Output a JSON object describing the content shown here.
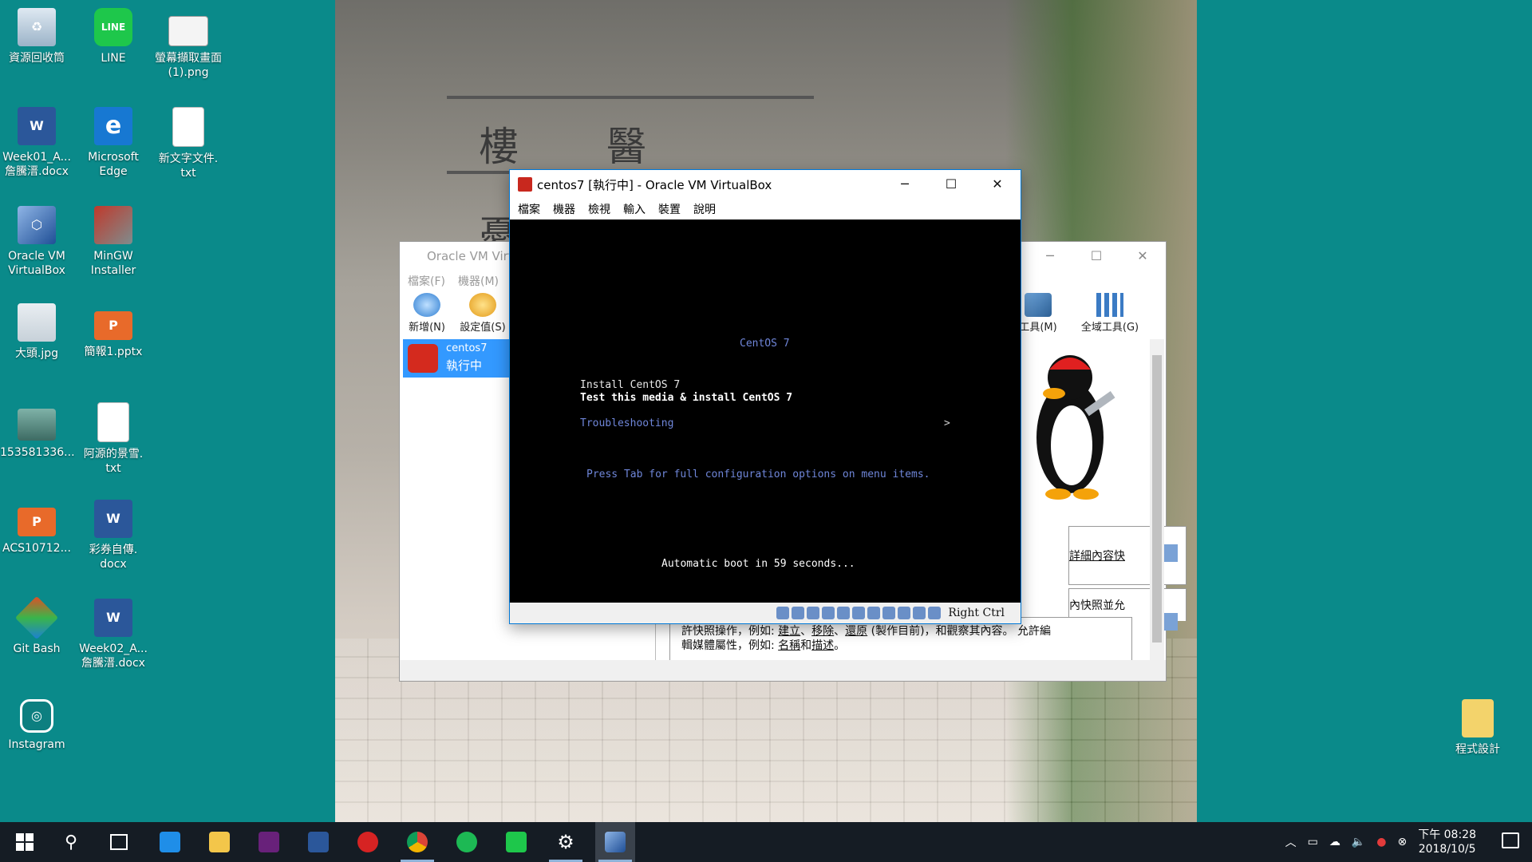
{
  "desktop_icons": [
    {
      "label": "資源回收筒",
      "icon": "recycle-bin-icon"
    },
    {
      "label": "LINE",
      "icon": "line-icon"
    },
    {
      "label": "螢幕擷取畫面\n(1).png",
      "icon": "image-file-icon"
    },
    {
      "label": "Week01_A...\n詹騰溍.docx",
      "icon": "word-doc-icon"
    },
    {
      "label": "Microsoft\nEdge",
      "icon": "edge-icon"
    },
    {
      "label": "新文字文件.\ntxt",
      "icon": "text-file-icon"
    },
    {
      "label": "Oracle VM\nVirtualBox",
      "icon": "virtualbox-icon"
    },
    {
      "label": "MinGW\nInstaller",
      "icon": "mingw-icon"
    },
    {
      "label": "大頭.jpg",
      "icon": "photo-icon"
    },
    {
      "label": "簡報1.pptx",
      "icon": "powerpoint-icon"
    },
    {
      "label": "153581336...",
      "icon": "photo-icon"
    },
    {
      "label": "阿源的景雪.\ntxt",
      "icon": "text-file-icon"
    },
    {
      "label": "ACS10712...",
      "icon": "powerpoint-icon"
    },
    {
      "label": "彩券自傳.\ndocx",
      "icon": "word-doc-icon"
    },
    {
      "label": "Git Bash",
      "icon": "git-bash-icon"
    },
    {
      "label": "Week02_A...\n詹騰溍.docx",
      "icon": "word-doc-icon"
    },
    {
      "label": "Instagram",
      "icon": "instagram-icon"
    },
    {
      "label": "程式設計",
      "icon": "folder-icon"
    }
  ],
  "wallpaper": {
    "sign": [
      "樓",
      "醫",
      "憂"
    ]
  },
  "manager": {
    "title": "Oracle VM Virt",
    "menu": [
      "檔案(F)",
      "機器(M)"
    ],
    "tools": {
      "new": "新增(N)",
      "settings": "設定值(S)",
      "machine_tools": "工具(M)",
      "global_tools": "全域工具(G)"
    },
    "vm": {
      "name": "centos7",
      "state": "執行中"
    },
    "details_link": "詳細內容快",
    "snapshot_partial": "內快照並允",
    "snapshot_line1_a": "許快照操作，例如: ",
    "snapshot_create": "建立",
    "snapshot_remove": "移除",
    "snapshot_restore": "還原",
    "snapshot_line1_b": " (製作目前)，和觀察其內容。 允許編",
    "snapshot_line2_a": "輯媒體屬性，例如: ",
    "snapshot_name": "名稱",
    "snapshot_and": "和",
    "snapshot_desc": "描述",
    "snapshot_end": "。"
  },
  "vm_window": {
    "title": "centos7 [執行中] - Oracle VM VirtualBox",
    "menu": [
      "檔案",
      "機器",
      "檢視",
      "輸入",
      "裝置",
      "說明"
    ],
    "boot": {
      "header": "CentOS 7",
      "option1": "Install CentOS 7",
      "option2": "Test this media & install CentOS 7",
      "option3": "Troubleshooting",
      "arrow": ">",
      "hint": "Press Tab for full configuration options on menu items.",
      "countdown": "Automatic boot in 59 seconds..."
    },
    "host_key": "Right Ctrl"
  },
  "taskbar": {
    "apps": [
      "start",
      "search",
      "task-view",
      "edge",
      "file-explorer",
      "visual-studio",
      "word",
      "garena",
      "chrome",
      "spotify",
      "line",
      "settings",
      "virtualbox"
    ],
    "clock_time": "下午 08:28",
    "clock_date": "2018/10/5"
  },
  "colors": {
    "desktop": "#0a8a8a",
    "selection": "#3399ff",
    "boot_text": "#6f86d9",
    "taskbar": "#151c24"
  }
}
